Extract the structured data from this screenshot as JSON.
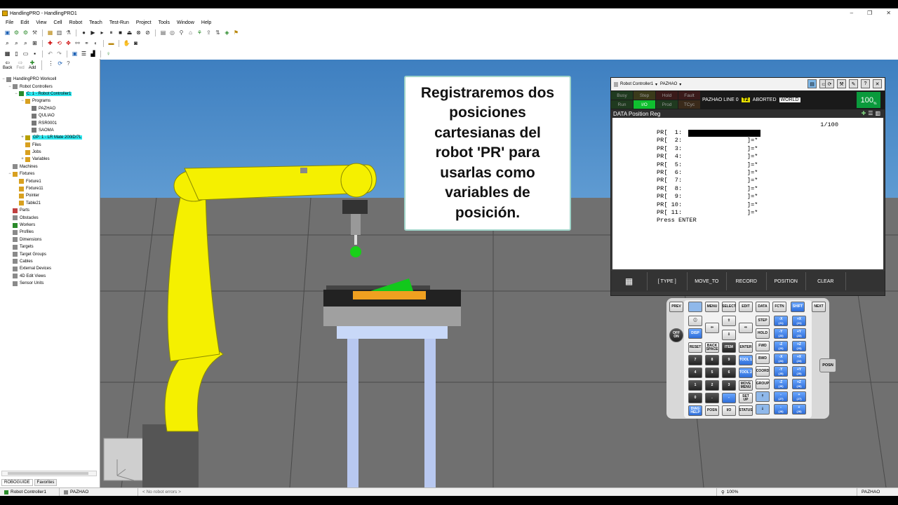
{
  "window": {
    "title": "HandlingPRO - HandlingPRO1",
    "controls": [
      "–",
      "❐",
      "✕"
    ]
  },
  "menu": [
    "File",
    "Edit",
    "View",
    "Cell",
    "Robot",
    "Teach",
    "Test-Run",
    "Project",
    "Tools",
    "Window",
    "Help"
  ],
  "nav": {
    "back": "Back",
    "fwd": "Fwd",
    "add": "Add"
  },
  "tree": [
    {
      "label": "HandlingPRO Workcell",
      "level": 0,
      "icon": "workcell-icon",
      "exp": "−"
    },
    {
      "label": "Robot Controllers",
      "level": 1,
      "icon": "controllers-icon",
      "exp": "−"
    },
    {
      "label": "C: 1 - Robot Controller1",
      "level": 2,
      "icon": "controller-icon",
      "exp": "−",
      "highlight": true
    },
    {
      "label": "Programs",
      "level": 3,
      "icon": "folder-icon",
      "exp": "−"
    },
    {
      "label": "PAZHAO",
      "level": 4,
      "icon": "program-icon",
      "exp": ""
    },
    {
      "label": "QULIAO",
      "level": 4,
      "icon": "program-icon",
      "exp": ""
    },
    {
      "label": "RSR0001",
      "level": 4,
      "icon": "program-icon",
      "exp": ""
    },
    {
      "label": "SAOMA",
      "level": 4,
      "icon": "program-icon",
      "exp": ""
    },
    {
      "label": "GP: 1 - LR Mate 200iD/7L",
      "level": 3,
      "icon": "robot-icon",
      "exp": "+",
      "highlight": true
    },
    {
      "label": "Files",
      "level": 3,
      "icon": "folder-icon",
      "exp": ""
    },
    {
      "label": "Jobs",
      "level": 3,
      "icon": "folder-icon",
      "exp": ""
    },
    {
      "label": "Variables",
      "level": 3,
      "icon": "folder-icon",
      "exp": "+"
    },
    {
      "label": "Machines",
      "level": 1,
      "icon": "machines-icon",
      "exp": ""
    },
    {
      "label": "Fixtures",
      "level": 1,
      "icon": "fixtures-icon",
      "exp": "−"
    },
    {
      "label": "Fixture1",
      "level": 2,
      "icon": "fixture-icon",
      "exp": ""
    },
    {
      "label": "Fixture11",
      "level": 2,
      "icon": "fixture-icon",
      "exp": ""
    },
    {
      "label": "Pointer",
      "level": 2,
      "icon": "fixture-icon",
      "exp": ""
    },
    {
      "label": "Table21",
      "level": 2,
      "icon": "fixture-icon",
      "exp": ""
    },
    {
      "label": "Parts",
      "level": 1,
      "icon": "parts-icon",
      "exp": ""
    },
    {
      "label": "Obstacles",
      "level": 1,
      "icon": "obstacles-icon",
      "exp": ""
    },
    {
      "label": "Workers",
      "level": 1,
      "icon": "workers-icon",
      "exp": ""
    },
    {
      "label": "Profiles",
      "level": 1,
      "icon": "profiles-icon",
      "exp": ""
    },
    {
      "label": "Dimensions",
      "level": 1,
      "icon": "dimensions-icon",
      "exp": ""
    },
    {
      "label": "Targets",
      "level": 1,
      "icon": "targets-icon",
      "exp": ""
    },
    {
      "label": "Target Groups",
      "level": 1,
      "icon": "target-groups-icon",
      "exp": ""
    },
    {
      "label": "Cables",
      "level": 1,
      "icon": "cables-icon",
      "exp": ""
    },
    {
      "label": "External Devices",
      "level": 1,
      "icon": "external-devices-icon",
      "exp": ""
    },
    {
      "label": "4D Edit Views",
      "level": 1,
      "icon": "edit-views-icon",
      "exp": ""
    },
    {
      "label": "Sensor Units",
      "level": 1,
      "icon": "sensor-units-icon",
      "exp": ""
    }
  ],
  "panel_tabs": [
    "ROBOGUIDE",
    "Favorites"
  ],
  "callout": "Registraremos dos posiciones cartesianas del robot 'PR' para usarlas como variables de posición.",
  "pendant": {
    "controller": "Robot Controller1",
    "program": "PAZHAO",
    "status_left": [
      [
        "Busy",
        "Step",
        "Hold",
        "Fault"
      ],
      [
        "Run",
        "I/O",
        "Prod",
        "TCyc"
      ]
    ],
    "status_line": {
      "program_line": "PAZHAO LINE 0",
      "mode": "T2",
      "state": "ABORTED",
      "frame": "WORLD"
    },
    "override": "100",
    "override_unit": "%",
    "screen_title": "DATA Position Reg",
    "counter": "1/100",
    "rows": [
      "PR[  1:                  ]=*",
      "PR[  2:                  ]=*",
      "PR[  3:                  ]=*",
      "PR[  4:                  ]=*",
      "PR[  5:                  ]=*",
      "PR[  6:                  ]=*",
      "PR[  7:                  ]=*",
      "PR[  8:                  ]=*",
      "PR[  9:                  ]=*",
      "PR[ 10:                  ]=*",
      "PR[ 11:                  ]=*"
    ],
    "prompt": "Press ENTER",
    "fkeys": [
      "[ TYPE ]",
      "MOVE_TO",
      "RECORD",
      "POSITION",
      "CLEAR"
    ],
    "keys": {
      "prev": "PREV",
      "menu": "MENU",
      "select": "SELECT",
      "edit": "EDIT",
      "data": "DATA",
      "fctn": "FCTN",
      "shift": "SHIFT",
      "next": "NEXT",
      "disp": "DISP",
      "step": "STEP",
      "hold": "HOLD",
      "fwd": "FWD",
      "bwd": "BWD",
      "coord": "COORD",
      "group": "GROUP",
      "reset": "RESET",
      "backspace": "BACK SPACE",
      "item": "ITEM",
      "enter": "ENTER",
      "tool1": "TOOL 1",
      "tool2": "TOOL 2",
      "movemenu": "MOVE MENU",
      "setup": "SET UP",
      "diag": "DIAG HELP",
      "posn": "POSN",
      "io": "I/O",
      "status": "STATUS",
      "offon": "OFF ON",
      "side_posn": "POSN",
      "digits": [
        "7",
        "8",
        "9",
        "4",
        "5",
        "6",
        "1",
        "2",
        "3",
        "0",
        ".",
        "-"
      ],
      "jog": [
        [
          "-X",
          "+X"
        ],
        [
          "-Y",
          "+Y"
        ],
        [
          "-Z",
          "+Z"
        ],
        [
          "-X",
          "+X"
        ],
        [
          "-Y",
          "+Y"
        ],
        [
          "-Z",
          "+Z"
        ],
        [
          "-",
          "+"
        ],
        [
          "-",
          "+"
        ]
      ],
      "jog_sub": [
        [
          "(J1)",
          "(J1)"
        ],
        [
          "(J2)",
          "(J2)"
        ],
        [
          "(J3)",
          "(J3)"
        ],
        [
          "(J4)",
          "(J4)"
        ],
        [
          "(J5)",
          "(J5)"
        ],
        [
          "(J6)",
          "(J6)"
        ],
        [
          "(J7)",
          "(J7)"
        ],
        [
          "(J8)",
          "(J8)"
        ]
      ]
    }
  },
  "statusbar": {
    "controller": "Robot Controller1",
    "program": "PAZHAO",
    "errors": "< No robot errors >",
    "zoom": "100%",
    "right_program": "PAZHAO"
  },
  "colors": {
    "robot": "#f5f000",
    "sky": "#4f8ccb",
    "floor": "#707070",
    "highlight": "#2ee8f0",
    "override": "#0a9a3c"
  }
}
